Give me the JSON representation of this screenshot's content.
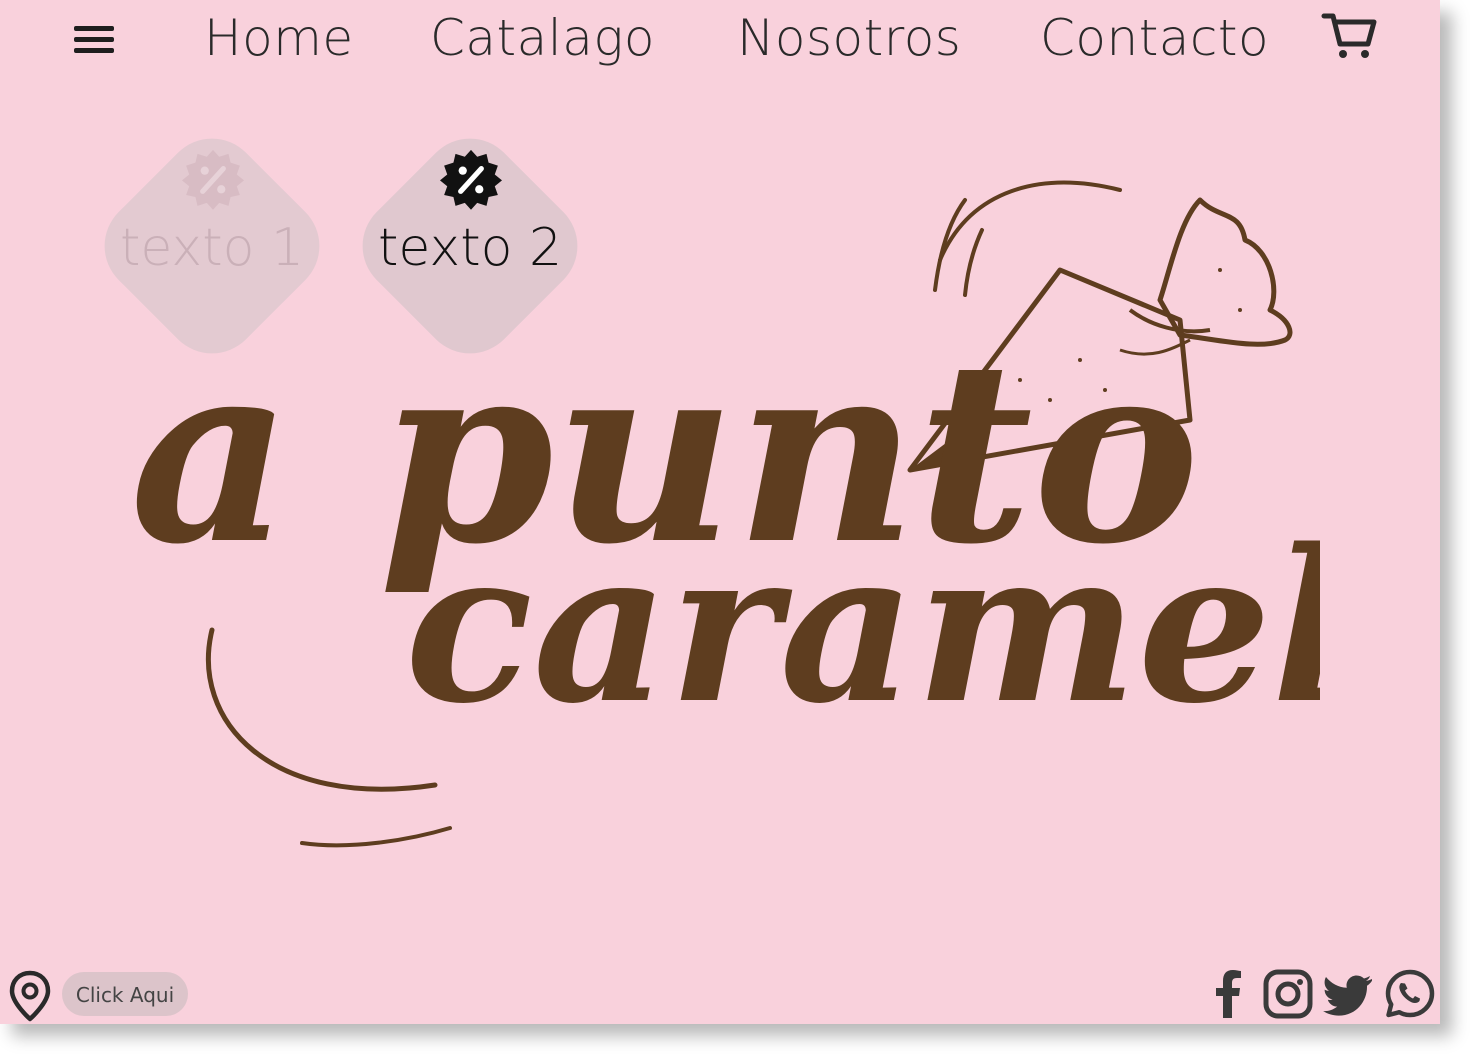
{
  "nav": {
    "menu_icon": "hamburger-menu-icon",
    "links": [
      "Home",
      "Catalago",
      "Nosotros",
      "Contacto"
    ],
    "cart_icon": "shopping-cart-icon"
  },
  "promos": [
    {
      "label": "texto 1",
      "icon": "discount-badge-icon",
      "state": "inactive"
    },
    {
      "label": "texto 2",
      "icon": "discount-badge-icon",
      "state": "active"
    }
  ],
  "logo": {
    "line1": "a punto",
    "line2": "caramelo",
    "icon": "piping-bag-icon"
  },
  "footer": {
    "location_icon": "location-pin-icon",
    "click_label": "Click Aqui",
    "social_icons": [
      "facebook-icon",
      "instagram-icon",
      "twitter-icon",
      "whatsapp-icon"
    ]
  },
  "colors": {
    "background": "#f9d1dc",
    "brand_brown": "#5e3d1f",
    "diamond": "#e0c8cf",
    "text_dark": "#2a2a2a",
    "icon_gray": "#3a3a3a"
  }
}
